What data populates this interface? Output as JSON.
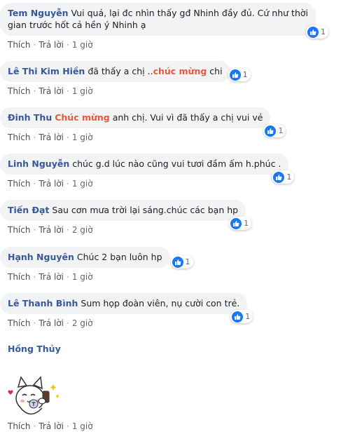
{
  "actions": {
    "like": "Thích",
    "reply": "Trả lời",
    "sep": "·"
  },
  "comments": [
    {
      "name": "Tem Nguyễn",
      "line1": "Vui quá, lại đc nhìn thấy gđ Nhinh đầy đủ. Cứ như thời",
      "line2": "gian trước hốt cả hền ý Nhinh ạ",
      "reactions": "1",
      "time": "1 giờ"
    },
    {
      "name": "Lê Thi Kim Hiền",
      "pre": "đã thấy a chị ..",
      "hl": "chúc mừng",
      "post": " chi",
      "reactions": "1",
      "time": "1 giờ"
    },
    {
      "name": "Đinh Thu",
      "hl": "Chúc mừng",
      "post": " anh chị. Vui vì đã thấy a chị vui vẻ",
      "reactions": "1",
      "time": "1 giờ"
    },
    {
      "name": "Linh Nguyễn",
      "text": "chúc g.d lúc nào cũng vui tươi đầm ấm h.phúc .",
      "reactions": "1",
      "time": "1 giờ"
    },
    {
      "name": "Tiến Đạt",
      "text": "Sau cơn mưa trời lại sáng.chúc các bạn hp",
      "reactions": "1",
      "time": "2 giờ"
    },
    {
      "name": "Hạnh Nguyên",
      "text": "Chúc 2 bạn luôn hp",
      "reactions": "1",
      "time": "1 giờ"
    },
    {
      "name": "Lê Thanh Bình",
      "text": "Sum họp đoàn viên, nụ cười con trẻ.",
      "reactions": "1",
      "time": "2 giờ"
    },
    {
      "name": "Hồng Thủy",
      "sticker": "cat-with-phone-sticker",
      "time": "1 giờ"
    }
  ],
  "colors": {
    "name": "#385898",
    "highlight": "#e9573f",
    "like": "#1877f2",
    "bubble": "#f2f3f5"
  }
}
